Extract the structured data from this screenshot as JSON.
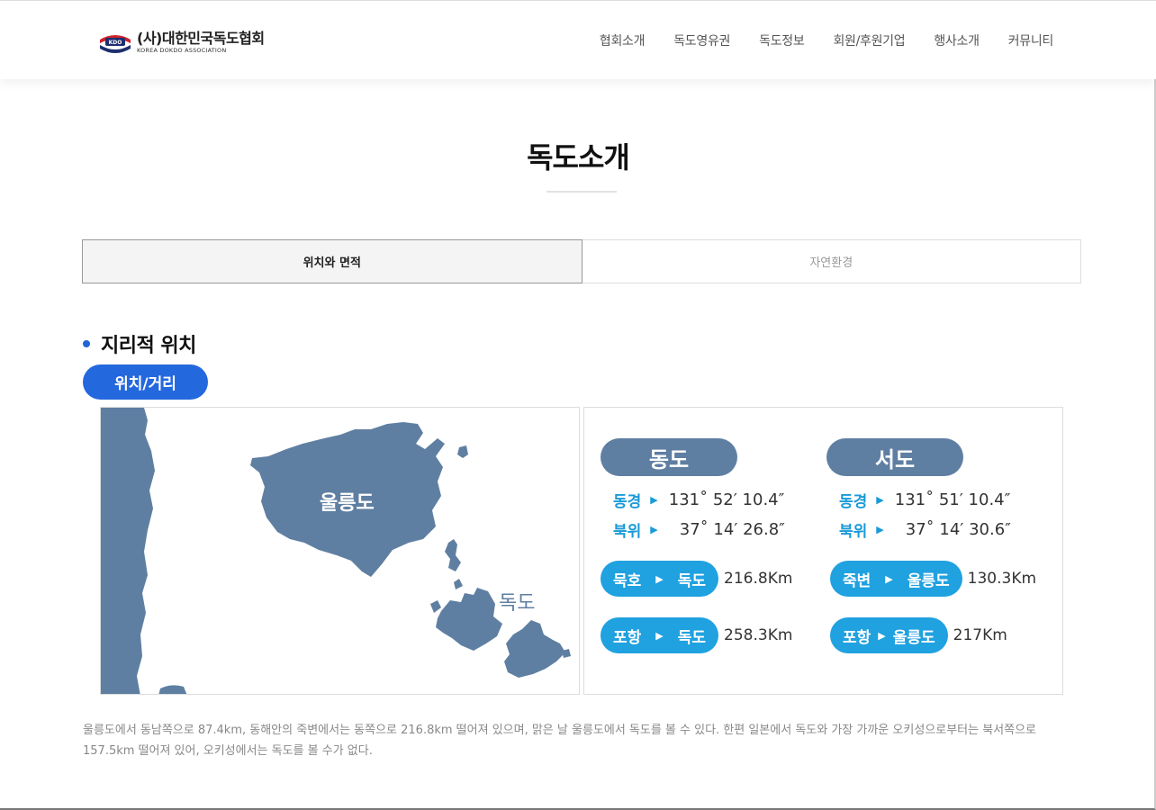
{
  "header": {
    "logo_main": "(사)대한민국독도협회",
    "logo_sub": "KOREA DOKDO ASSOCIATION",
    "nav": [
      "협회소개",
      "독도영유권",
      "독도정보",
      "회원/후원기업",
      "행사소개",
      "커뮤니티"
    ]
  },
  "page_title": "독도소개",
  "tabs": [
    {
      "label": "위치와 면적",
      "active": true
    },
    {
      "label": "자연환경",
      "active": false
    }
  ],
  "section": {
    "title": "지리적 위치",
    "badge": "위치/거리"
  },
  "map": {
    "ulleungdo_label": "울릉도",
    "dokdo_label": "독도",
    "land_color": "#5f7fa2"
  },
  "info": {
    "dongdo": {
      "name": "동도",
      "east_key": "동경",
      "east_val": "131˚ 52′ 10.4″",
      "north_key": "북위",
      "north_val": "37˚ 14′ 26.8″"
    },
    "seodo": {
      "name": "서도",
      "east_key": "동경",
      "east_val": "131˚ 51′ 10.4″",
      "north_key": "북위",
      "north_val": "37˚ 14′ 30.6″"
    },
    "routes": [
      {
        "from": "묵호",
        "to": "독도",
        "dist": "216.8Km"
      },
      {
        "from": "죽변",
        "to": "울릉도",
        "dist": "130.3Km"
      },
      {
        "from": "포항",
        "to": "독도",
        "dist": "258.3Km"
      },
      {
        "from": "포항",
        "to": "울릉도",
        "dist": "217Km"
      }
    ]
  },
  "description": "울릉도에서 동남쪽으로 87.4km, 동해안의 죽변에서는 동쪽으로 216.8km 떨어져 있으며, 맑은 날 울릉도에서 독도를 볼 수 있다. 한편 일본에서 독도와 가장 가까운 오키성으로부터는 북서쪽으로 157.5km 떨어져 있어, 오키성에서는 독도를 볼 수가 없다.",
  "colors": {
    "accent_blue": "#2468de",
    "route_blue": "#20a1e0",
    "slate": "#5f7fa2"
  }
}
